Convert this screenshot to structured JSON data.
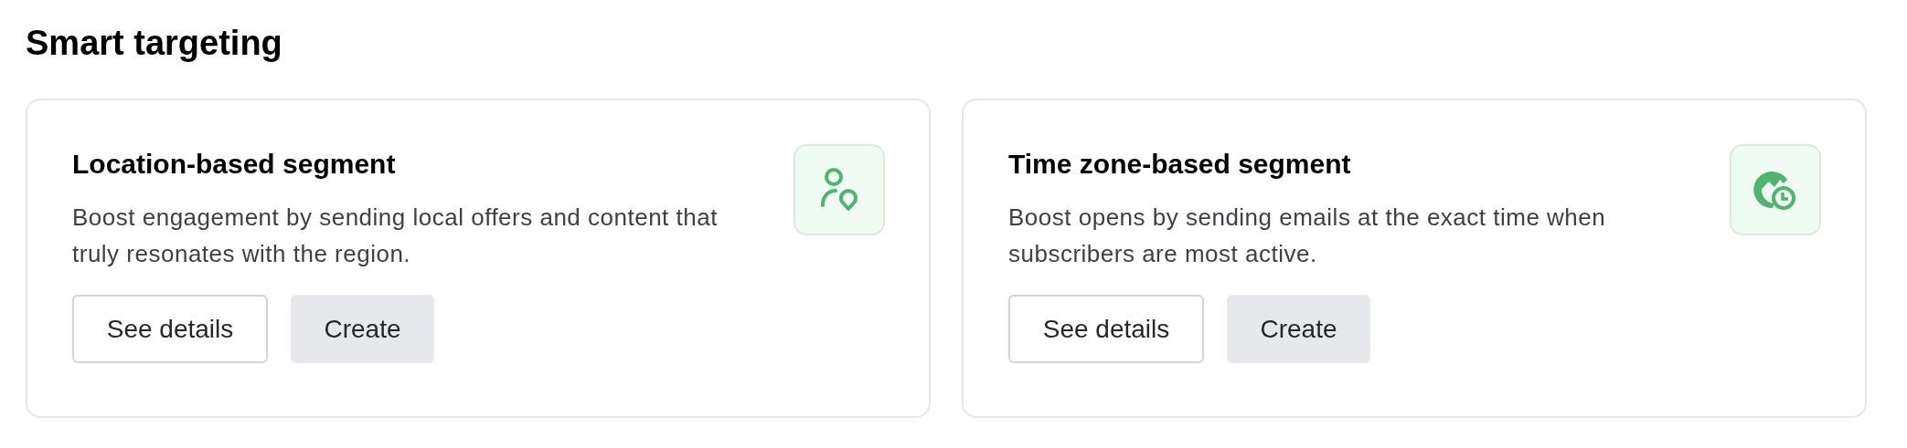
{
  "heading": "Smart targeting",
  "cards": [
    {
      "kind": "location",
      "title": "Location-based segment",
      "description": "Boost engagement by sending local offers and content that truly resonates with the region.",
      "buttons": [
        "See details",
        "Create"
      ]
    },
    {
      "kind": "timezone",
      "title": "Time zone-based segment",
      "description": "Boost opens by sending emails at the exact time when subscribers are most active.",
      "buttons": [
        "See details",
        "Create"
      ]
    }
  ]
}
